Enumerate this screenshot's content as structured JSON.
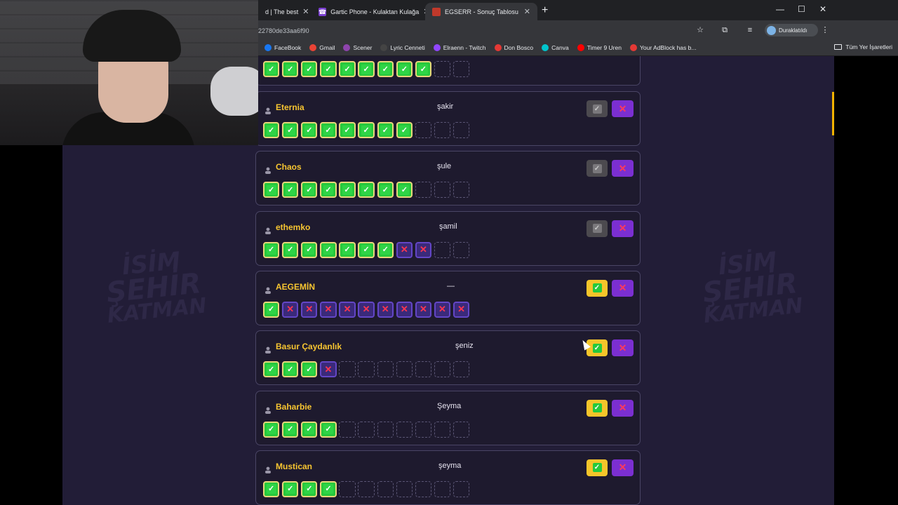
{
  "browser": {
    "tabs": [
      {
        "title": "d | The best",
        "favicon": "generic",
        "active": false
      },
      {
        "title": "Gartic Phone - Kulaktan Kulağa",
        "favicon": "gartic",
        "active": false
      },
      {
        "title": "EGSERR - Sonuç Tablosu",
        "favicon": "egserr",
        "active": true
      }
    ],
    "url": "22780de33aa6f90",
    "profile_label": "Duraklatıldı",
    "bookmarks": [
      {
        "label": "FaceBook",
        "color": "#1877f2"
      },
      {
        "label": "Gmail",
        "color": "#ea4335"
      },
      {
        "label": "Scener",
        "color": "#8e44ad"
      },
      {
        "label": "Lyric Cenneti",
        "color": "#444444"
      },
      {
        "label": "Elraenn - Twitch",
        "color": "#9146ff"
      },
      {
        "label": "Don Bosco",
        "color": "#e53935"
      },
      {
        "label": "Canva",
        "color": "#00c4cc"
      },
      {
        "label": "Timer 9 Uren",
        "color": "#ff0000"
      },
      {
        "label": "Your AdBlock has b...",
        "color": "#e53935"
      }
    ],
    "all_bookmarks_label": "Tüm Yer İşaretleri"
  },
  "page": {
    "watermark": {
      "line1": "İSİM",
      "line2": "ŞEHİR",
      "line3": "KATMAN"
    },
    "top_partial_slots": [
      "ok",
      "ok",
      "ok",
      "ok",
      "ok",
      "ok",
      "ok",
      "ok",
      "ok",
      "empty",
      "empty"
    ],
    "players": [
      {
        "name": "Eternia",
        "answer": "şakir",
        "approved": false,
        "slots": [
          "ok",
          "ok",
          "ok",
          "ok",
          "ok",
          "ok",
          "ok",
          "ok",
          "empty",
          "empty",
          "empty"
        ]
      },
      {
        "name": "Chaos",
        "answer": "şule",
        "approved": false,
        "slots": [
          "ok",
          "ok",
          "ok",
          "ok",
          "ok",
          "ok",
          "ok",
          "ok",
          "empty",
          "empty",
          "empty"
        ]
      },
      {
        "name": "ethemko",
        "answer": "şamil",
        "approved": false,
        "slots": [
          "ok",
          "ok",
          "ok",
          "ok",
          "ok",
          "ok",
          "ok",
          "no",
          "no",
          "empty",
          "empty"
        ]
      },
      {
        "name": "AEGEMİN",
        "answer": "—",
        "approved": true,
        "slots": [
          "ok",
          "no",
          "no",
          "no",
          "no",
          "no",
          "no",
          "no",
          "no",
          "no",
          "no"
        ]
      },
      {
        "name": "Basur Çaydanlık",
        "answer": "şeniz",
        "approved": true,
        "slots": [
          "ok",
          "ok",
          "ok",
          "no",
          "empty",
          "empty",
          "empty",
          "empty",
          "empty",
          "empty",
          "empty"
        ]
      },
      {
        "name": "Baharbie",
        "answer": "Şeyma",
        "approved": true,
        "slots": [
          "ok",
          "ok",
          "ok",
          "ok",
          "empty",
          "empty",
          "empty",
          "empty",
          "empty",
          "empty",
          "empty"
        ]
      },
      {
        "name": "Mustican",
        "answer": "şeyma",
        "approved": true,
        "slots": [
          "ok",
          "ok",
          "ok",
          "ok",
          "empty",
          "empty",
          "empty",
          "empty",
          "empty",
          "empty",
          "empty"
        ]
      }
    ]
  }
}
